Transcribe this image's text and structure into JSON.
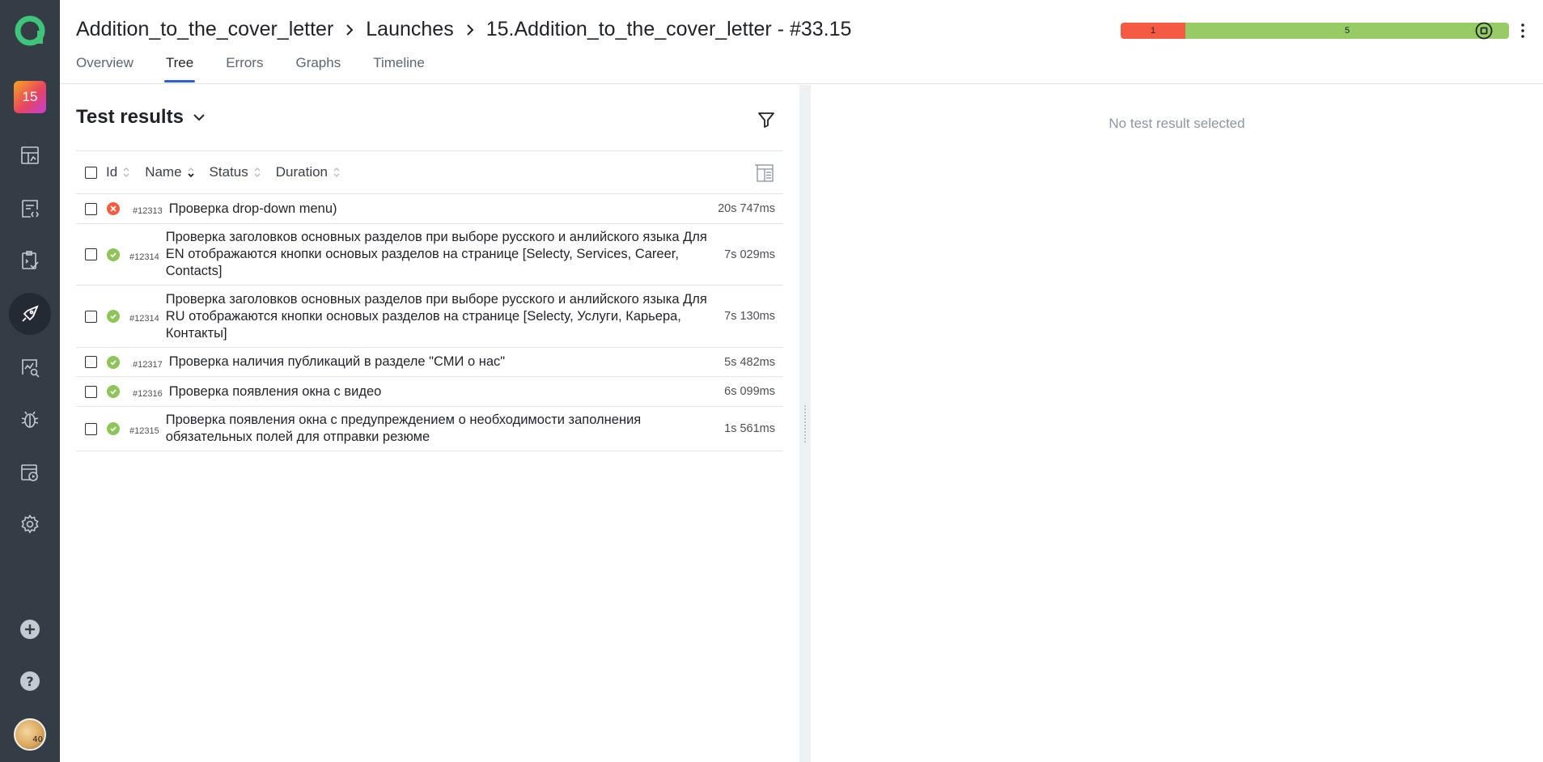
{
  "sidebar": {
    "project_badge": "15",
    "avatar_badge": "40",
    "items": [
      {
        "icon": "logo-icon"
      },
      {
        "icon": "project-badge"
      },
      {
        "icon": "dashboards-icon"
      },
      {
        "icon": "test-cases-icon"
      },
      {
        "icon": "test-plans-icon"
      },
      {
        "icon": "launches-icon",
        "active": true
      },
      {
        "icon": "analytics-icon"
      },
      {
        "icon": "defects-icon"
      },
      {
        "icon": "jobs-icon"
      },
      {
        "icon": "settings-icon"
      },
      {
        "icon": "add-icon"
      },
      {
        "icon": "help-icon"
      },
      {
        "icon": "avatar"
      }
    ]
  },
  "header": {
    "breadcrumb": [
      "Addition_to_the_cover_letter",
      "Launches",
      "15.Addition_to_the_cover_letter - #33.15"
    ],
    "tabs": [
      "Overview",
      "Tree",
      "Errors",
      "Graphs",
      "Timeline"
    ],
    "active_tab": "Tree",
    "stats": {
      "failed": "1",
      "passed": "5",
      "failed_fraction": 0.1667
    },
    "colors": {
      "failed": "#f55b43",
      "passed": "#97cc64",
      "accent": "#2f5ee0"
    }
  },
  "left": {
    "title": "Test results",
    "columns": {
      "id": "Id",
      "name": "Name",
      "status": "Status",
      "duration": "Duration"
    },
    "rows": [
      {
        "id": "#12313",
        "status": "failed",
        "name": "Проверка drop-down menu)",
        "duration": "20s 747ms"
      },
      {
        "id": "#12314",
        "status": "passed",
        "name": "Проверка заголовков основных разделов при выборе русского и анлийского языка Для EN отображаются кнопки основых разделов на странице [Selecty, Services, Career, Contacts]",
        "duration": "7s 029ms"
      },
      {
        "id": "#12314",
        "status": "passed",
        "name": "Проверка заголовков основных разделов при выборе русского и анлийского языка Для RU отображаются кнопки основых разделов на странице [Selecty, Услуги, Карьера, Контакты]",
        "duration": "7s 130ms"
      },
      {
        "id": "#12317",
        "status": "passed",
        "name": "Проверка наличия публикаций в разделе \"СМИ о нас\"",
        "duration": "5s 482ms"
      },
      {
        "id": "#12316",
        "status": "passed",
        "name": "Проверка появления окна с видео",
        "duration": "6s 099ms"
      },
      {
        "id": "#12315",
        "status": "passed",
        "name": "Проверка появления окна с предупреждением о необходимости заполнения обязательных полей для отправки резюме",
        "duration": "1s 561ms"
      }
    ]
  },
  "right": {
    "empty_message": "No test result selected"
  }
}
